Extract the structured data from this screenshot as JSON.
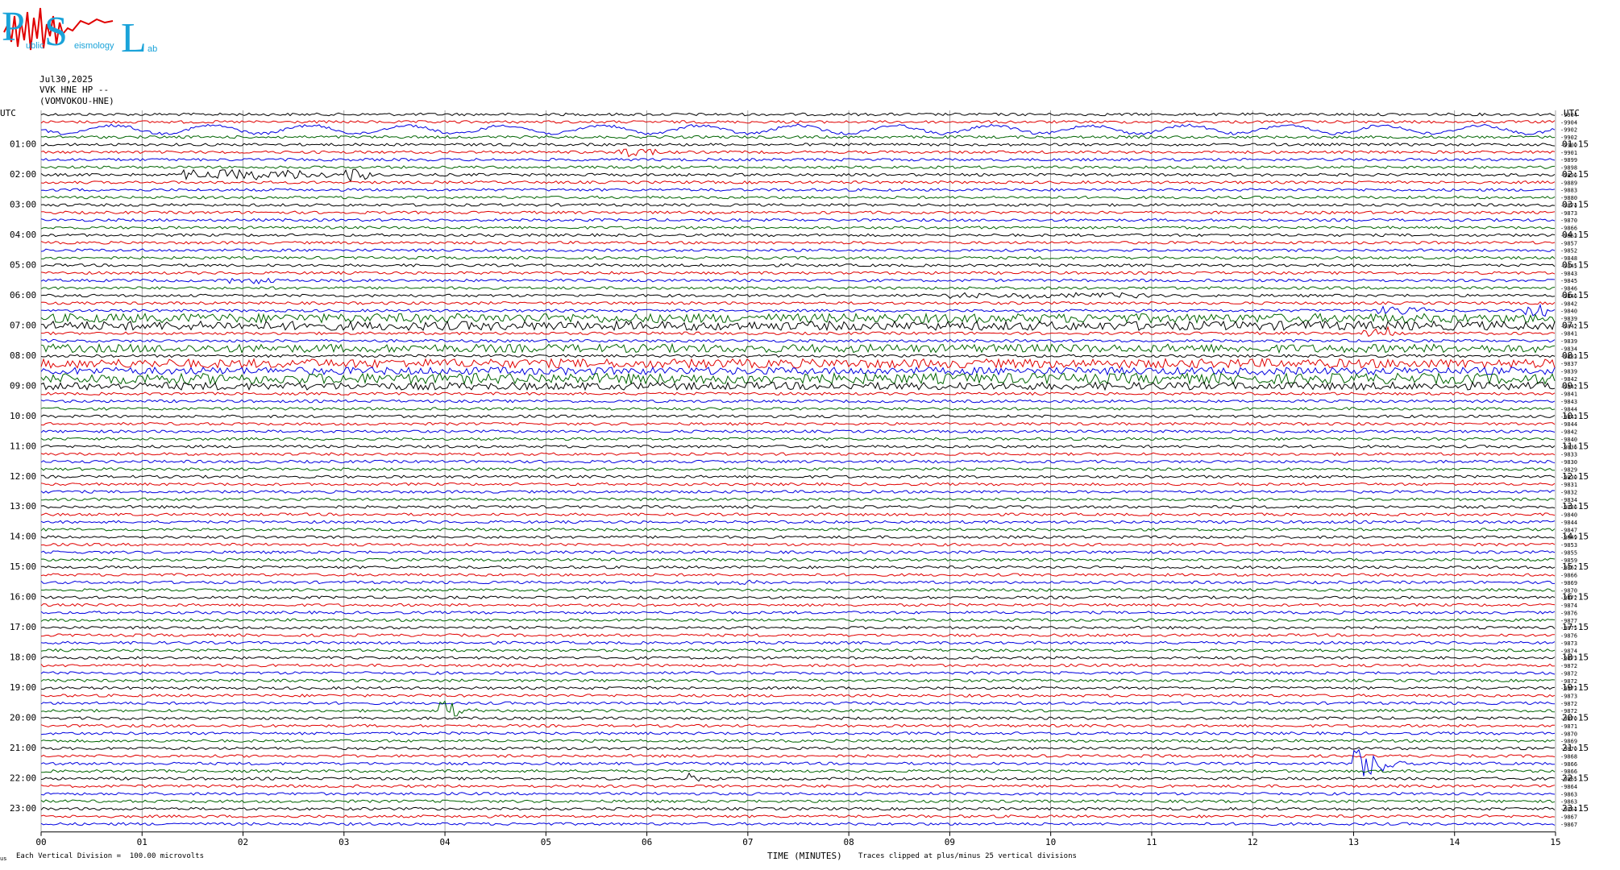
{
  "logo": {
    "big_letters": [
      "P",
      "S",
      "L"
    ],
    "small_words": [
      "ublic",
      "eismology",
      "ab"
    ]
  },
  "header": {
    "date": "Jul30,2025",
    "station": "VVK HNE HP --",
    "name": "(VOMVOKOU-HNE)"
  },
  "footer": {
    "scale": "Each Vertical Division =  100.00 microvolts",
    "xlabel": "TIME (MINUTES)",
    "clip": "Traces clipped at plus/minus 25 vertical divisions",
    "corner": "us"
  },
  "colors": {
    "trace_cycle": [
      "#000000",
      "#e00000",
      "#0000e0",
      "#006400"
    ],
    "grid": "#808080"
  },
  "chart_data": {
    "type": "line",
    "subtype": "helicorder",
    "title": "",
    "xlabel": "TIME (MINUTES)",
    "xlim": [
      0,
      15
    ],
    "x_ticks": [
      "00",
      "01",
      "02",
      "03",
      "04",
      "05",
      "06",
      "07",
      "08",
      "09",
      "10",
      "11",
      "12",
      "13",
      "14",
      "15"
    ],
    "left_axis_label": "UTC",
    "right_axis_label": "UTC",
    "left_hour_labels": [
      "01:00",
      "02:00",
      "03:00",
      "04:00",
      "05:00",
      "06:00",
      "07:00",
      "08:00",
      "09:00",
      "10:00",
      "11:00",
      "12:00",
      "13:00",
      "14:00",
      "15:00",
      "16:00",
      "17:00",
      "18:00",
      "19:00",
      "20:00",
      "21:00",
      "22:00",
      "23:00"
    ],
    "right_hour_labels": [
      "01:15",
      "02:15",
      "03:15",
      "04:15",
      "05:15",
      "06:15",
      "07:15",
      "08:15",
      "09:15",
      "10:15",
      "11:15",
      "12:15",
      "13:15",
      "14:15",
      "15:15",
      "16:15",
      "17:15",
      "18:15",
      "19:15",
      "20:15",
      "21:15",
      "22:15",
      "23:15"
    ],
    "traces_per_hour": 4,
    "minutes_per_trace": 15,
    "right_offsets": [
      "-9904",
      "-9904",
      "-9902",
      "-9902",
      "-9900",
      "-9901",
      "-9899",
      "-9898",
      "-9896",
      "-9889",
      "-9883",
      "-9880",
      "-9874",
      "-9873",
      "-9870",
      "-9866",
      "-9863",
      "-9857",
      "-9852",
      "-9848",
      "-9845",
      "-9843",
      "-9845",
      "-9846",
      "-9846",
      "-9842",
      "-9840",
      "-9839",
      "-9842",
      "-9841",
      "-9839",
      "-9834",
      "-9833",
      "-9837",
      "-9839",
      "-9842",
      "-9842",
      "-9841",
      "-9843",
      "-9844",
      "-9843",
      "-9844",
      "-9842",
      "-9840",
      "-9836",
      "-9833",
      "-9830",
      "-9829",
      "-9830",
      "-9831",
      "-9832",
      "-9834",
      "-9836",
      "-9840",
      "-9844",
      "-9847",
      "-9849",
      "-9853",
      "-9855",
      "-9859",
      "-9862",
      "-9866",
      "-9869",
      "-9870",
      "-9872",
      "-9874",
      "-9876",
      "-9877",
      "-9875",
      "-9876",
      "-9873",
      "-9874",
      "-9873",
      "-9872",
      "-9872",
      "-9872",
      "-9873",
      "-9873",
      "-9872",
      "-9872",
      "-9870",
      "-9871",
      "-9870",
      "-9869",
      "-9870",
      "-9868",
      "-9866",
      "-9866",
      "-9865",
      "-9864",
      "-9863",
      "-9863",
      "-9864",
      "-9867",
      "-9867"
    ],
    "events": [
      {
        "trace": 2,
        "t_min": 0.0,
        "dur_min": 15,
        "kind": "swell",
        "amp": 0.9
      },
      {
        "trace": 5,
        "t_min": 5.7,
        "dur_min": 0.4,
        "kind": "burst",
        "amp": 0.6
      },
      {
        "trace": 8,
        "t_min": 1.4,
        "dur_min": 1.5,
        "kind": "burst",
        "amp": 0.6
      },
      {
        "trace": 8,
        "t_min": 3.0,
        "dur_min": 0.3,
        "kind": "burst",
        "amp": 0.8
      },
      {
        "trace": 22,
        "t_min": 1.8,
        "dur_min": 0.5,
        "kind": "burst",
        "amp": 0.4
      },
      {
        "trace": 24,
        "t_min": 9.0,
        "dur_min": 2.0,
        "kind": "burst",
        "amp": 0.25
      },
      {
        "trace": 26,
        "t_min": 14.7,
        "dur_min": 0.2,
        "kind": "burst",
        "amp": 0.8
      },
      {
        "trace": 26,
        "t_min": 13.2,
        "dur_min": 0.5,
        "kind": "burst",
        "amp": 0.5
      },
      {
        "trace": 27,
        "t_min": 0.0,
        "dur_min": 15,
        "kind": "noisy",
        "amp": 0.6
      },
      {
        "trace": 28,
        "t_min": 0.0,
        "dur_min": 15,
        "kind": "noisy",
        "amp": 0.6
      },
      {
        "trace": 29,
        "t_min": 13.1,
        "dur_min": 0.3,
        "kind": "burst",
        "amp": 0.7
      },
      {
        "trace": 31,
        "t_min": 0.0,
        "dur_min": 15,
        "kind": "noisy",
        "amp": 0.55
      },
      {
        "trace": 33,
        "t_min": 0.0,
        "dur_min": 15,
        "kind": "noisy",
        "amp": 0.6
      },
      {
        "trace": 34,
        "t_min": 0.0,
        "dur_min": 15,
        "kind": "noisy",
        "amp": 0.5
      },
      {
        "trace": 35,
        "t_min": 0.0,
        "dur_min": 15,
        "kind": "noisy",
        "amp": 0.7
      },
      {
        "trace": 36,
        "t_min": 0.0,
        "dur_min": 15,
        "kind": "noisy",
        "amp": 0.5
      },
      {
        "trace": 62,
        "t_min": 6.7,
        "dur_min": 0.4,
        "kind": "burst",
        "amp": 0.3
      },
      {
        "trace": 79,
        "t_min": 3.95,
        "dur_min": 0.4,
        "kind": "quake",
        "amp": 2.2
      },
      {
        "trace": 86,
        "t_min": 13.0,
        "dur_min": 0.8,
        "kind": "quake",
        "amp": 3.0
      },
      {
        "trace": 88,
        "t_min": 6.4,
        "dur_min": 0.3,
        "kind": "quake",
        "amp": 1.2
      }
    ]
  }
}
